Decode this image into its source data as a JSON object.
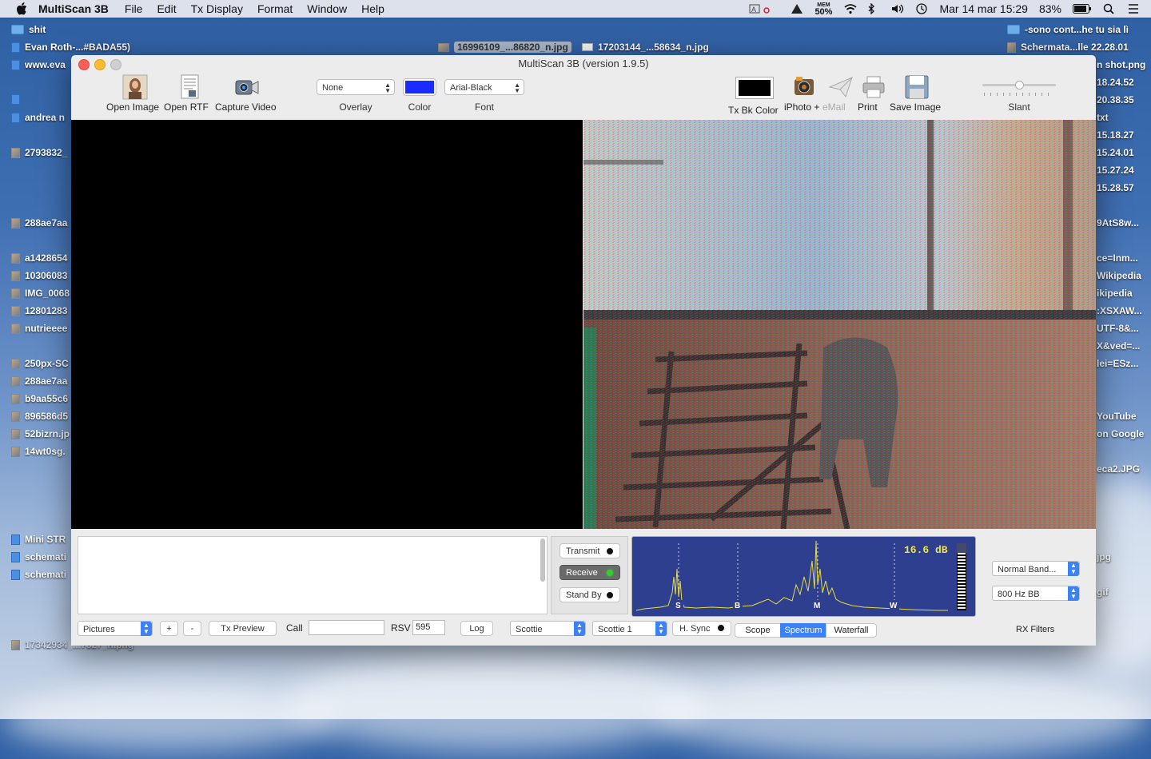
{
  "menubar": {
    "app": "MultiScan 3B",
    "items": [
      "File",
      "Edit",
      "Tx Display",
      "Format",
      "Window",
      "Help"
    ],
    "status": {
      "mem_label": "MEM",
      "mem_value": "50%",
      "clock": "Mar 14 mar  15:29",
      "battery": "83%"
    }
  },
  "desktop": {
    "left_icons": [
      {
        "label": "shit",
        "type": "folder"
      },
      {
        "label": "Evan Roth-...#BADA55)",
        "type": "doc"
      },
      {
        "label": "www.eva",
        "type": "doc"
      },
      {
        "label": "",
        "type": "doc"
      },
      {
        "label": "andrea n",
        "type": "doc"
      },
      {
        "label": "2793832_",
        "type": "img"
      },
      {
        "label": "288ae7aa",
        "type": "img"
      },
      {
        "label": "a1428654",
        "type": "img"
      },
      {
        "label": "10306083",
        "type": "img"
      },
      {
        "label": "IMG_0068",
        "type": "img"
      },
      {
        "label": "12801283",
        "type": "img"
      },
      {
        "label": "nutrieeee",
        "type": "img"
      },
      {
        "label": "250px-SC",
        "type": "img"
      },
      {
        "label": "288ae7aa",
        "type": "img"
      },
      {
        "label": "b9aa55c6",
        "type": "img"
      },
      {
        "label": "896586d5",
        "type": "img"
      },
      {
        "label": "52bizrn.jp",
        "type": "img"
      },
      {
        "label": "14wt0sg.",
        "type": "img"
      },
      {
        "label": "Mini STR",
        "type": "doc"
      },
      {
        "label": "schemati",
        "type": "doc"
      },
      {
        "label": "schemati",
        "type": "doc"
      },
      {
        "label": "17342934_...7327_n.png",
        "type": "img"
      }
    ],
    "top_files": [
      {
        "label": "16996109_...86820_n.jpg",
        "selected": true
      },
      {
        "label": "17203144_...58634_n.jpg",
        "selected": false
      }
    ],
    "right_icons": [
      {
        "label": "-sono cont...he tu sia lì",
        "type": "folder"
      },
      {
        "label": "Schermata...lle 22.28.01",
        "type": "img"
      },
      {
        "label": "n shot.png"
      },
      {
        "label": "18.24.52"
      },
      {
        "label": "20.38.35"
      },
      {
        "label": "txt"
      },
      {
        "label": "15.18.27"
      },
      {
        "label": "15.24.01"
      },
      {
        "label": "15.27.24"
      },
      {
        "label": "15.28.57"
      },
      {
        "label": "9AtS8w..."
      },
      {
        "label": "ce=Inm..."
      },
      {
        "label": "Wikipedia"
      },
      {
        "label": "ikipedia"
      },
      {
        "label": ":XSXAW..."
      },
      {
        "label": "UTF-8&..."
      },
      {
        "label": "X&ved=..."
      },
      {
        "label": "lei=ESz..."
      },
      {
        "label": "YouTube"
      },
      {
        "label": "on Google"
      },
      {
        "label": "eca2.JPG"
      },
      {
        "label": "jpg"
      },
      {
        "label": "gif"
      }
    ]
  },
  "window": {
    "title": "MultiScan 3B (version 1.9.5)",
    "toolbar": {
      "open_image": "Open Image",
      "open_rtf": "Open RTF",
      "capture_video": "Capture Video",
      "overlay_value": "None",
      "overlay_label": "Overlay",
      "color_label": "Color",
      "color_value": "#1a2cff",
      "font_value": "Arial-Black",
      "font_label": "Font",
      "tx_bk_color": "Tx Bk Color",
      "iphoto": "iPhoto +",
      "email": "eMail",
      "print": "Print",
      "save_image": "Save Image",
      "slant": "Slant",
      "slant_level": 0.5
    },
    "bottom": {
      "pictures_value": "Pictures",
      "plus": "+",
      "minus": "-",
      "tx_preview": "Tx Preview",
      "call_label": "Call",
      "call_value": "",
      "rsv_label": "RSV",
      "rsv_value": "595",
      "log": "Log",
      "mode_family": "Scottie",
      "mode": "Scottie 1",
      "hsync": "H. Sync",
      "transmit": "Transmit",
      "receive": "Receive",
      "standby": "Stand By",
      "db_readout": "16.6 dB",
      "markers": [
        "S",
        "B",
        "M",
        "W"
      ],
      "view_tabs": [
        {
          "label": "Scope",
          "active": false
        },
        {
          "label": "Spectrum",
          "active": true
        },
        {
          "label": "Waterfall",
          "active": false
        }
      ],
      "band_filter": "Normal Band...",
      "bb_filter": "800 Hz BB",
      "rx_filters": "RX Filters"
    }
  }
}
